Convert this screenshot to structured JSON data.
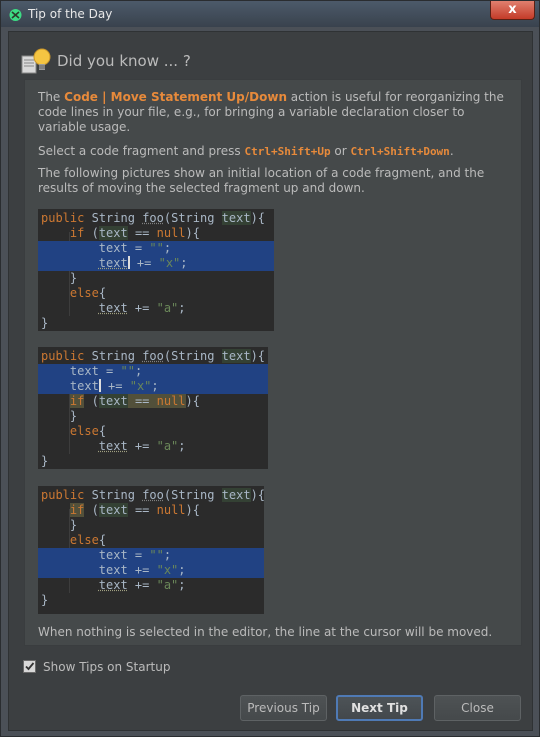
{
  "window": {
    "title": "Tip of the Day",
    "close_glyph": "x"
  },
  "header": {
    "title": "Did you know ... ?",
    "icon": "lightbulb-icon"
  },
  "tip": {
    "p1_before": "The ",
    "p1_action": "Code | Move Statement Up/Down",
    "p1_after": " action is useful for reorganizing the code lines in your file, e.g., for bringing a variable declaration closer to variable usage.",
    "p2_before": "Select a code fragment and press ",
    "p2_key1": "Ctrl+Shift+Up",
    "p2_mid": " or ",
    "p2_key2": "Ctrl+Shift+Down",
    "p2_after": ".",
    "p3": "The following pictures show an initial location of a code fragment, and the results of moving the selected fragment up and down.",
    "footer": "When nothing is selected in the editor, the line at the cursor will be moved."
  },
  "code": {
    "kw_public": "public",
    "type_string": "String",
    "method_name": "foo",
    "param_open": "(String ",
    "param_name": "text",
    "param_close": "){",
    "kw_if": "if",
    "kw_null": "null",
    "kw_else": "else",
    "var": "text",
    "str_empty": "\"\"",
    "str_x": "\"x\"",
    "str_a": "\"a\""
  },
  "controls": {
    "show_tips_label": "Show Tips on Startup",
    "show_tips_checked": true,
    "prev_label": "Previous Tip",
    "next_label": "Next Tip",
    "close_label": "Close"
  },
  "colors": {
    "accent": "#e78a3b",
    "selection": "#214283",
    "editor_bg": "#2b2b2b",
    "keyword": "#cc7832",
    "string": "#6a8759"
  }
}
